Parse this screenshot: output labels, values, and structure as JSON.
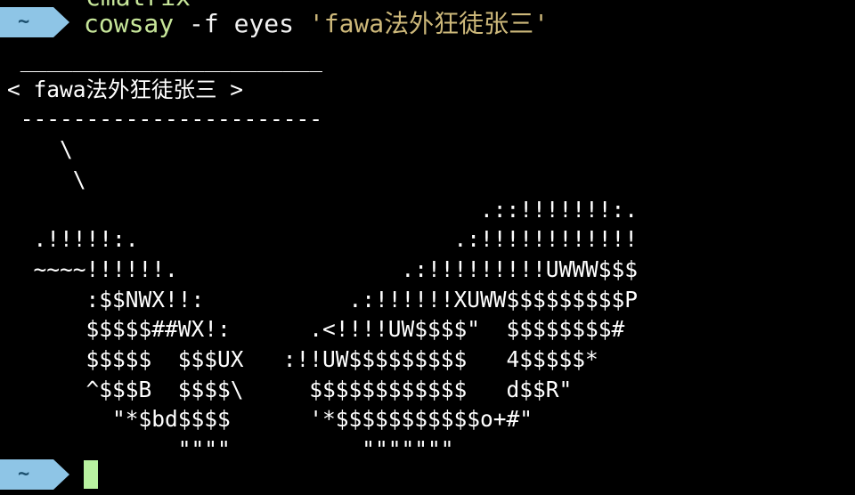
{
  "terminal": {
    "partial_previous_line": "cmatrix",
    "prompt_symbol": "~",
    "command": {
      "program": "cowsay",
      "args": " -f eyes ",
      "string": "'fawa法外狂徒张三'"
    },
    "output_lines": [
      " _______________________",
      "< fawa法外狂徒张三 >",
      " -----------------------",
      "    \\",
      "     \\",
      "                                    .::!!!!!!!:.",
      "  .!!!!!:.                        .:!!!!!!!!!!!!",
      "  ~~~~!!!!!!.                 .:!!!!!!!!!UWWW$$$",
      "      :$$NWX!!:           .:!!!!!!XUWW$$$$$$$$$P",
      "      $$$$$##WX!:      .<!!!!UW$$$$\"  $$$$$$$$#",
      "      $$$$$  $$$UX   :!!UW$$$$$$$$$   4$$$$$*",
      "      ^$$$B  $$$$\\     $$$$$$$$$$$$   d$$R\"",
      "        \"*$bd$$$$      '*$$$$$$$$$$$o+#\"",
      "             \"\"\"\"          \"\"\"\"\"\"\""
    ],
    "colors": {
      "background": "#000000",
      "prompt_badge": "#8ec5e6",
      "prompt_text": "#1b4f6e",
      "program": "#c7e69a",
      "string": "#cdb87a",
      "output": "#ffffff",
      "cursor": "#b9f2a0"
    }
  }
}
